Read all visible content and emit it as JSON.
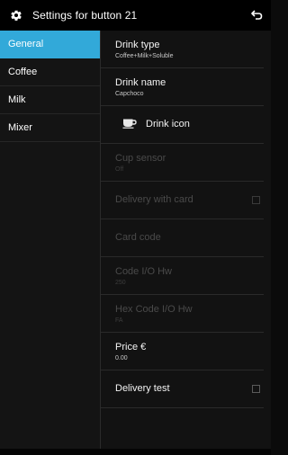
{
  "header": {
    "title": "Settings for button 21",
    "settings_icon": "gear-icon",
    "back_icon": "back-return-icon"
  },
  "sidebar": {
    "items": [
      {
        "label": "General",
        "active": true
      },
      {
        "label": "Coffee",
        "active": false
      },
      {
        "label": "Milk",
        "active": false
      },
      {
        "label": "Mixer",
        "active": false
      }
    ]
  },
  "settings": {
    "drink_type": {
      "label": "Drink type",
      "value": "Coffee+Milk+Soluble"
    },
    "drink_name": {
      "label": "Drink name",
      "value": "Capchoco"
    },
    "drink_icon": {
      "label": "Drink icon",
      "icon": "coffee-cup-icon"
    },
    "cup_sensor": {
      "label": "Cup sensor",
      "value": "Off"
    },
    "delivery_with_card": {
      "label": "Delivery with card",
      "checked": false
    },
    "card_code": {
      "label": "Card code"
    },
    "code_io_hw": {
      "label": "Code I/O Hw",
      "value": "250"
    },
    "hex_code_io_hw": {
      "label": "Hex Code I/O Hw",
      "value": "FA"
    },
    "price": {
      "label": "Price €",
      "value": "0.00"
    },
    "delivery_test": {
      "label": "Delivery test",
      "checked": false
    }
  },
  "colors": {
    "accent": "#32a9d9",
    "background": "#111111",
    "disabled_text": "#4a4a4a"
  }
}
